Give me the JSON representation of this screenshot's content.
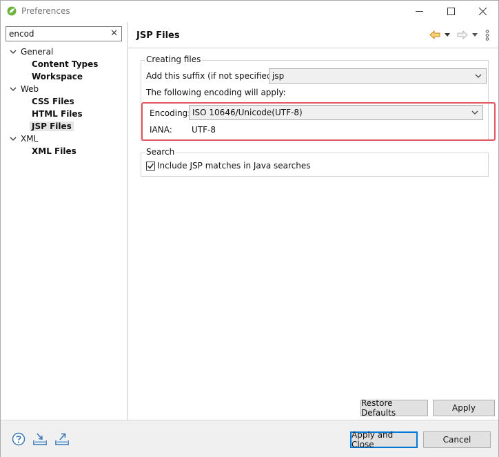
{
  "window": {
    "title": "Preferences",
    "min_glyph": "—",
    "max_glyph": "☐",
    "close_glyph": "✕"
  },
  "filter": {
    "value": "encod",
    "clear_glyph": "✕"
  },
  "tree": {
    "general": "General",
    "content_types": "Content Types",
    "workspace": "Workspace",
    "web": "Web",
    "css_files": "CSS Files",
    "html_files": "HTML Files",
    "jsp_files": "JSP Files",
    "xml": "XML",
    "xml_files": "XML Files",
    "expanded_glyph": "⌄"
  },
  "page": {
    "title": "JSP Files",
    "creating_files": {
      "label": "Creating files",
      "suffix_label": "Add this suffix (if not specified):",
      "suffix_value": "jsp",
      "encoding_note": "The following encoding will apply:",
      "encoding_label": "Encoding:",
      "encoding_value": "ISO 10646/Unicode(UTF-8)",
      "iana_label": "IANA:",
      "iana_value": "UTF-8"
    },
    "search": {
      "label": "Search",
      "include_label": "Include JSP matches in Java searches",
      "include_checked": true
    },
    "restore_defaults": "Restore Defaults",
    "apply": "Apply"
  },
  "footer": {
    "apply_and_close": "Apply and Close",
    "cancel": "Cancel"
  },
  "colors": {
    "highlight": "#e05560",
    "primary_border": "#0078d7",
    "nav_back": "#e8a33b"
  },
  "icons": [
    "spring-app-icon",
    "help-icon",
    "import-icon",
    "export-icon",
    "back-arrow-icon",
    "forward-arrow-icon",
    "view-menu-icon"
  ]
}
